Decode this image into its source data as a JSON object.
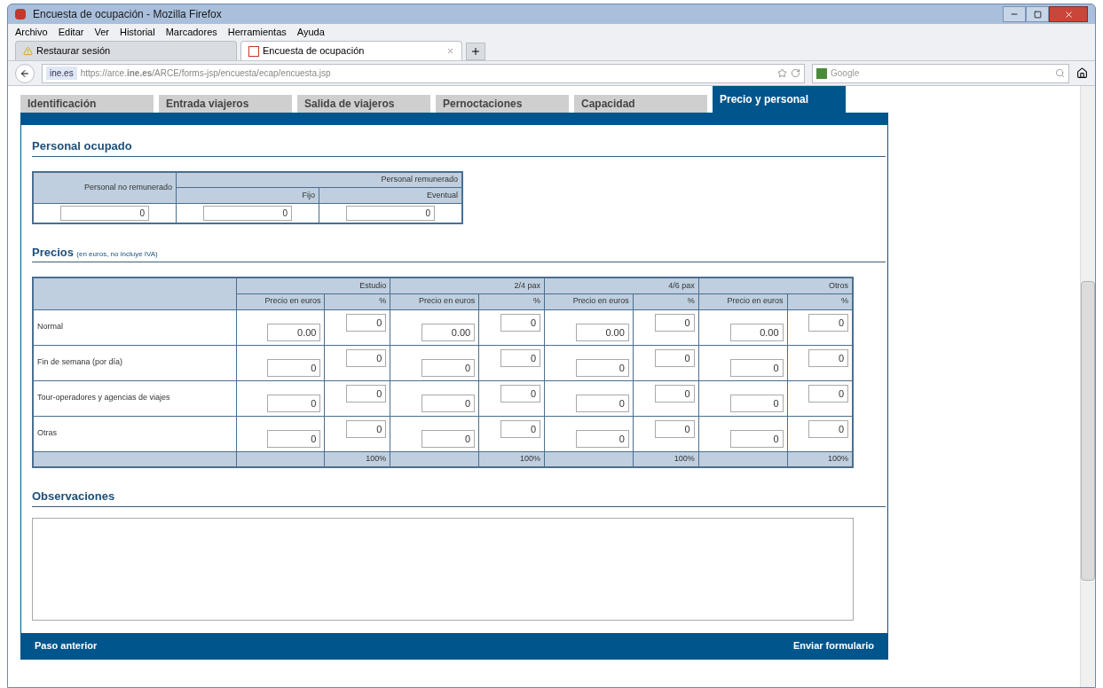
{
  "window": {
    "title": "Encuesta de ocupación - Mozilla Firefox"
  },
  "menu": [
    "Archivo",
    "Editar",
    "Ver",
    "Historial",
    "Marcadores",
    "Herramientas",
    "Ayuda"
  ],
  "browser_tabs": [
    {
      "label": "Restaurar sesión",
      "selected": false,
      "kind": "warning"
    },
    {
      "label": "Encuesta de ocupación",
      "selected": true,
      "kind": "form"
    }
  ],
  "address": {
    "identity": "ine.es",
    "url": "https://arce.**ine.es**/ARCE/forms-jsp/encuesta/ecap/encuesta.jsp"
  },
  "search": {
    "placeholder": "Google"
  },
  "page_tabs": [
    {
      "label": "Identificación",
      "selected": false
    },
    {
      "label": "Entrada viajeros",
      "selected": false
    },
    {
      "label": "Salida de viajeros",
      "selected": false
    },
    {
      "label": "Pernoctaciones",
      "selected": false
    },
    {
      "label": "Capacidad",
      "selected": false
    },
    {
      "label": "Precio y personal",
      "selected": true
    }
  ],
  "personal": {
    "title": "Personal ocupado",
    "unpaid_header": "Personal no remunerado",
    "paid_header": "Personal remunerado",
    "paid_columns": [
      "Fijo",
      "Eventual"
    ],
    "values": [
      "0",
      "0",
      "0"
    ]
  },
  "precios": {
    "title": "Precios",
    "note": "(en euros, no incluye IVA)",
    "groups": [
      {
        "label": "Estudio",
        "subcolumns": [
          "Precio en euros",
          "%"
        ]
      },
      {
        "label": "2/4 pax",
        "subcolumns": [
          "Precio en euros",
          "%"
        ]
      },
      {
        "label": "4/6 pax",
        "subcolumns": [
          "Precio en euros",
          "%"
        ]
      },
      {
        "label": "Otros",
        "subcolumns": [
          "Precio en euros",
          "%"
        ]
      }
    ],
    "rows": [
      {
        "label": "Normal",
        "cells": [
          "0.00",
          "0",
          "0.00",
          "0",
          "0.00",
          "0",
          "0.00",
          "0"
        ]
      },
      {
        "label": "Fin de semana (por día)",
        "cells": [
          "0",
          "0",
          "0",
          "0",
          "0",
          "0",
          "0",
          "0"
        ]
      },
      {
        "label": "Tour-operadores y agencias de viajes",
        "cells": [
          "0",
          "0",
          "0",
          "0",
          "0",
          "0",
          "0",
          "0"
        ]
      },
      {
        "label": "Otras",
        "cells": [
          "0",
          "0",
          "0",
          "0",
          "0",
          "0",
          "0",
          "0"
        ]
      }
    ],
    "totals": [
      "100%",
      "100%",
      "100%",
      "100%"
    ]
  },
  "observaciones": {
    "title": "Observaciones"
  },
  "footer": {
    "back": "Paso anterior",
    "submit": "Enviar formulario"
  }
}
